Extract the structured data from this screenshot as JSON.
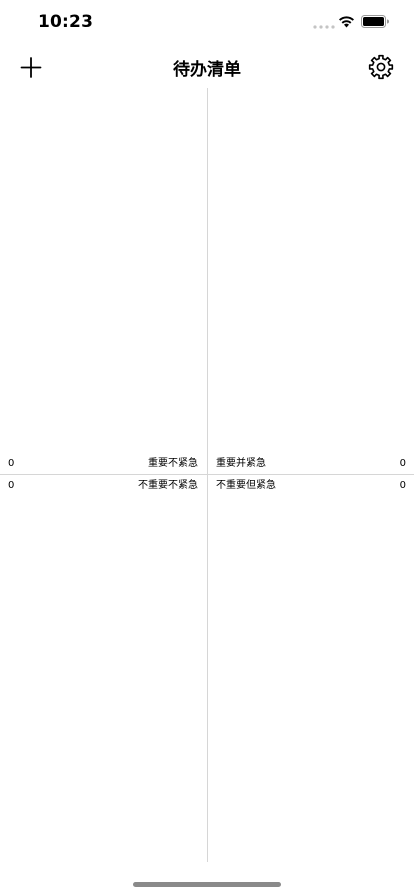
{
  "status_bar": {
    "time": "10:23"
  },
  "nav": {
    "title": "待办清单",
    "add_icon": "plus-icon",
    "settings_icon": "gear-icon"
  },
  "quadrants": {
    "not_important_urgent": {
      "count": "0",
      "label": "重要不紧急"
    },
    "important_urgent": {
      "count": "0",
      "label": "重要并紧急"
    },
    "not_important_not_urgent": {
      "count": "0",
      "label": "不重要不紧急"
    },
    "not_important_but_urgent": {
      "count": "0",
      "label": "不重要但紧急"
    }
  },
  "colors": {
    "divider": "#d6d6d6",
    "text": "#000000",
    "background": "#ffffff"
  }
}
